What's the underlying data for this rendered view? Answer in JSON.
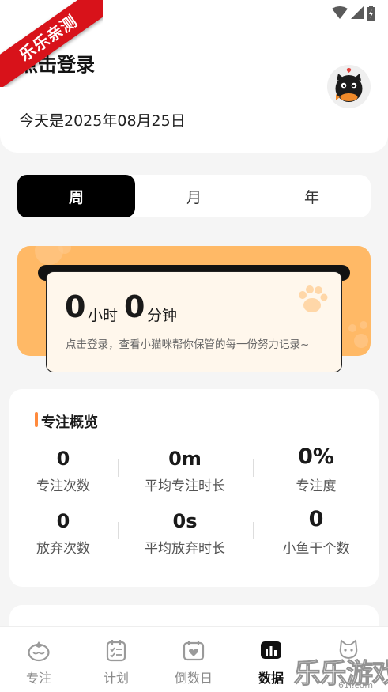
{
  "status_bar": {
    "icons": [
      "app-notification-icon",
      "wifi-icon",
      "signal-icon",
      "battery-charging-icon"
    ]
  },
  "ribbon": {
    "text": "乐乐亲测"
  },
  "header": {
    "login_title": "点击登录",
    "date_text": "今天是2025年08月25日",
    "avatar_icon": "black-cat-avatar-icon"
  },
  "period_tabs": [
    {
      "label": "周",
      "active": true
    },
    {
      "label": "月",
      "active": false
    },
    {
      "label": "年",
      "active": false
    }
  ],
  "focus_time": {
    "hours": "0",
    "hours_unit": "小时",
    "minutes": "0",
    "minutes_unit": "分钟",
    "hint": "点击登录，查看小猫咪帮你保管的每一份努力记录~"
  },
  "overview": {
    "title": "专注概览",
    "stats": [
      {
        "value": "0",
        "label": "专注次数"
      },
      {
        "value": "0m",
        "label": "平均专注时长"
      },
      {
        "value": "0%",
        "label": "专注度"
      },
      {
        "value": "0",
        "label": "放弃次数"
      },
      {
        "value": "0s",
        "label": "平均放弃时长"
      },
      {
        "value": "0",
        "label": "小鱼干个数"
      }
    ]
  },
  "bottom_nav": [
    {
      "label": "专注",
      "icon": "tomato-icon",
      "active": false
    },
    {
      "label": "计划",
      "icon": "checklist-calendar-icon",
      "active": false
    },
    {
      "label": "倒数日",
      "icon": "heart-calendar-icon",
      "active": false
    },
    {
      "label": "数据",
      "icon": "bar-chart-icon",
      "active": true
    },
    {
      "label": "",
      "icon": "cat-icon",
      "active": false
    }
  ],
  "watermark": {
    "text": "乐乐游戏",
    "url": "61l.com"
  },
  "colors": {
    "accent_orange": "#ffb966",
    "title_bar_orange": "#ff8a3d",
    "ribbon_red": "#d8121a",
    "active_tab_black": "#000000"
  }
}
